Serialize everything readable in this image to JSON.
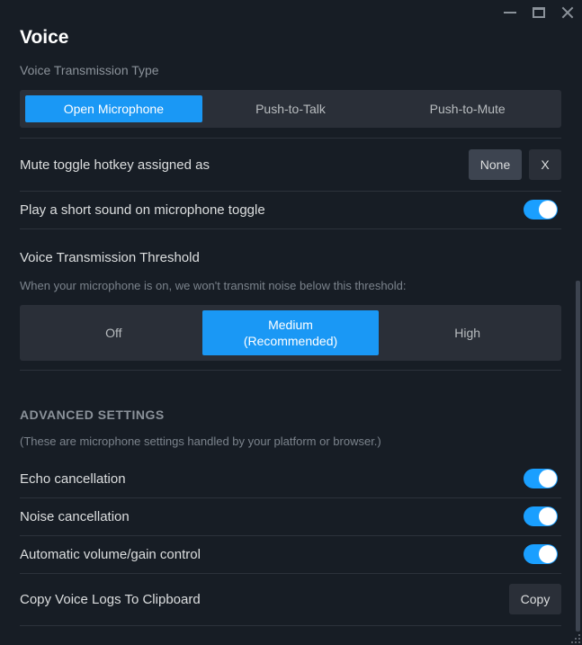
{
  "window": {
    "controls": {
      "minimize": "minimize-icon",
      "maximize": "maximize-icon",
      "close": "close-icon"
    }
  },
  "page": {
    "title": "Voice"
  },
  "transmission_type": {
    "label": "Voice Transmission Type",
    "options": [
      {
        "label": "Open Microphone",
        "active": true
      },
      {
        "label": "Push-to-Talk",
        "active": false
      },
      {
        "label": "Push-to-Mute",
        "active": false
      }
    ]
  },
  "mute_hotkey": {
    "label": "Mute toggle hotkey assigned as",
    "value": "None",
    "clear_label": "X"
  },
  "toggle_sound": {
    "label": "Play a short sound on microphone toggle",
    "enabled": true
  },
  "threshold": {
    "heading": "Voice Transmission Threshold",
    "description": "When your microphone is on, we won't transmit noise below this threshold:",
    "options": [
      {
        "label": "Off",
        "active": false
      },
      {
        "label": "Medium",
        "label2": "(Recommended)",
        "active": true
      },
      {
        "label": "High",
        "active": false
      }
    ]
  },
  "advanced": {
    "heading": "ADVANCED SETTINGS",
    "description": "(These are microphone settings handled by your platform or browser.)",
    "toggles": [
      {
        "label": "Echo cancellation",
        "enabled": true
      },
      {
        "label": "Noise cancellation",
        "enabled": true
      },
      {
        "label": "Automatic volume/gain control",
        "enabled": true
      }
    ],
    "copy_logs": {
      "label": "Copy Voice Logs To Clipboard",
      "button": "Copy"
    }
  },
  "colors": {
    "background": "#171d25",
    "accent": "#1a9fff",
    "segment_bg": "#2a2f38",
    "muted_text": "#8b929a"
  }
}
